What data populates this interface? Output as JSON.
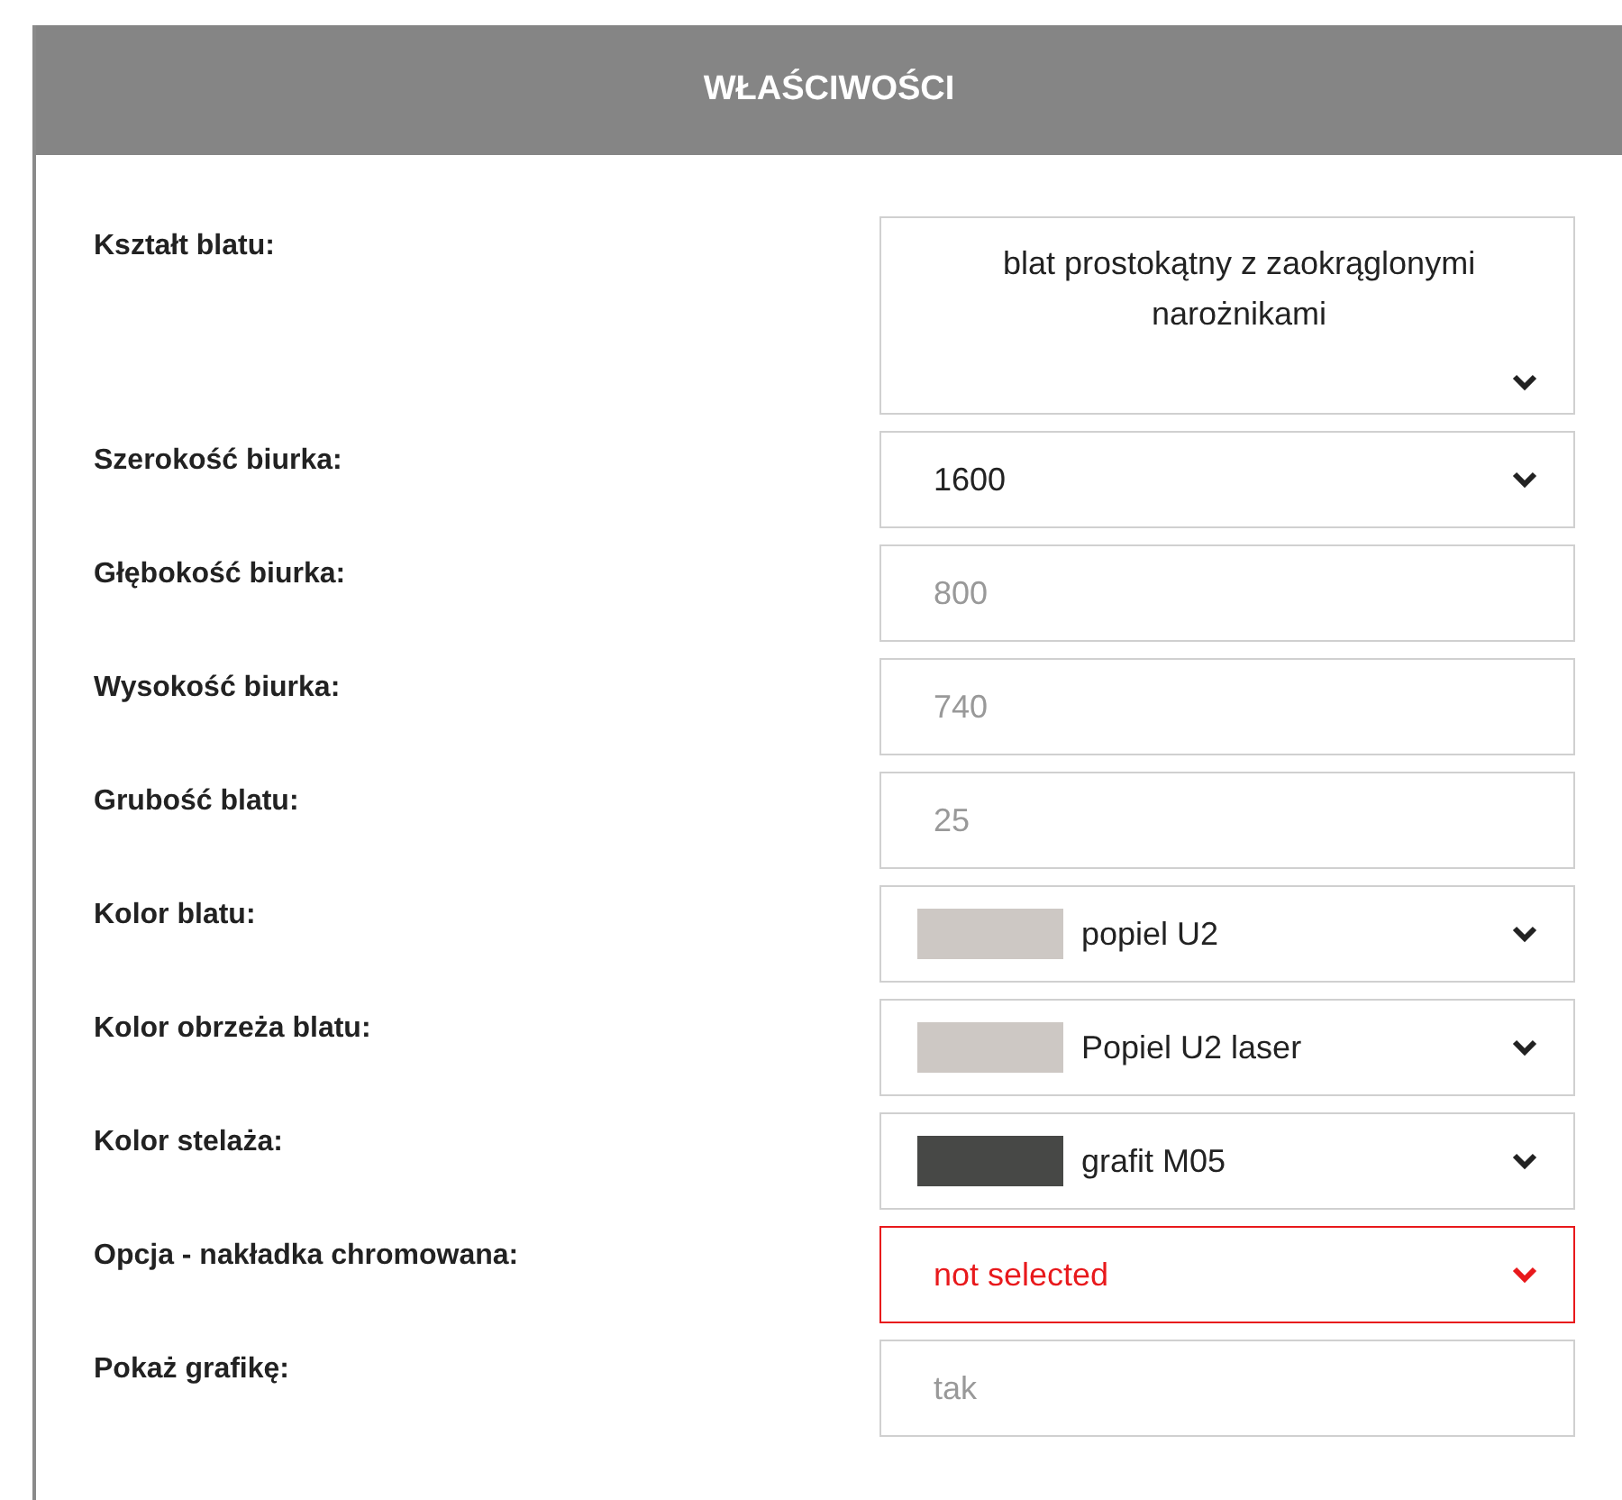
{
  "panel": {
    "title": "WŁAŚCIWOŚCI"
  },
  "rows": [
    {
      "label": "Kształt blatu:",
      "field": {
        "kind": "select",
        "value": "blat prostokątny z zaokrąglonymi narożnikami",
        "multiline": true,
        "error": false
      }
    },
    {
      "label": "Szerokość biurka:",
      "field": {
        "kind": "select",
        "value": "1600",
        "multiline": false,
        "error": false
      }
    },
    {
      "label": "Głębokość biurka:",
      "field": {
        "kind": "readonly",
        "value": "800"
      }
    },
    {
      "label": "Wysokość biurka:",
      "field": {
        "kind": "readonly",
        "value": "740"
      }
    },
    {
      "label": "Grubość blatu:",
      "field": {
        "kind": "readonly",
        "value": "25"
      }
    },
    {
      "label": "Kolor blatu:",
      "field": {
        "kind": "swatch",
        "value": "popiel U2",
        "color": "#cdc8c4"
      }
    },
    {
      "label": "Kolor obrzeża blatu:",
      "field": {
        "kind": "swatch",
        "value": "Popiel U2 laser",
        "color": "#cdc8c4"
      }
    },
    {
      "label": "Kolor stelaża:",
      "field": {
        "kind": "swatch",
        "value": "grafit M05",
        "color": "#474846"
      }
    },
    {
      "label": "Opcja - nakładka chromowana:",
      "field": {
        "kind": "select",
        "value": "not selected",
        "multiline": false,
        "error": true
      }
    },
    {
      "label": "Pokaż grafikę:",
      "field": {
        "kind": "readonly",
        "value": "tak"
      }
    }
  ]
}
